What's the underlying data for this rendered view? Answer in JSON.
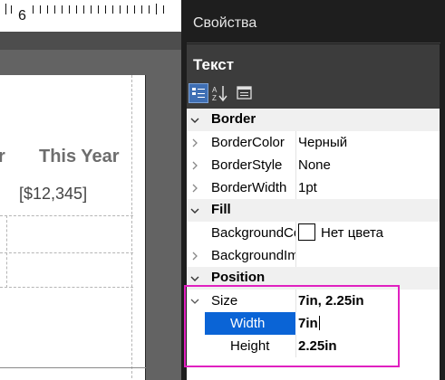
{
  "ruler": {
    "label": "6"
  },
  "report": {
    "column_header_fragment": "r",
    "column_header": "This Year",
    "cell_value": "[$12,345]"
  },
  "panel": {
    "title": "Свойства",
    "object_name": "Текст",
    "toolbar": {
      "categorized_icon": "categorized-icon",
      "alphabetical_icon": "sort-alphabetical-icon",
      "property_pages_icon": "property-pages-icon"
    },
    "categories": {
      "border": "Border",
      "fill": "Fill",
      "position": "Position"
    },
    "properties": {
      "border_color": {
        "name": "BorderColor",
        "value": "Черный"
      },
      "border_style": {
        "name": "BorderStyle",
        "value": "None"
      },
      "border_width": {
        "name": "BorderWidth",
        "value": "1pt"
      },
      "background_color": {
        "name": "BackgroundColor",
        "value": "Нет цвета"
      },
      "background_image": {
        "name": "BackgroundImage",
        "value": ""
      },
      "size": {
        "name": "Size",
        "value": "7in, 2.25in"
      },
      "width": {
        "name": "Width",
        "value": "7in"
      },
      "height": {
        "name": "Height",
        "value": "2.25in"
      }
    }
  },
  "colors": {
    "selection": "#0a64d6",
    "highlight_box": "#e020c0",
    "panel_dark": "#1e1e1e"
  }
}
